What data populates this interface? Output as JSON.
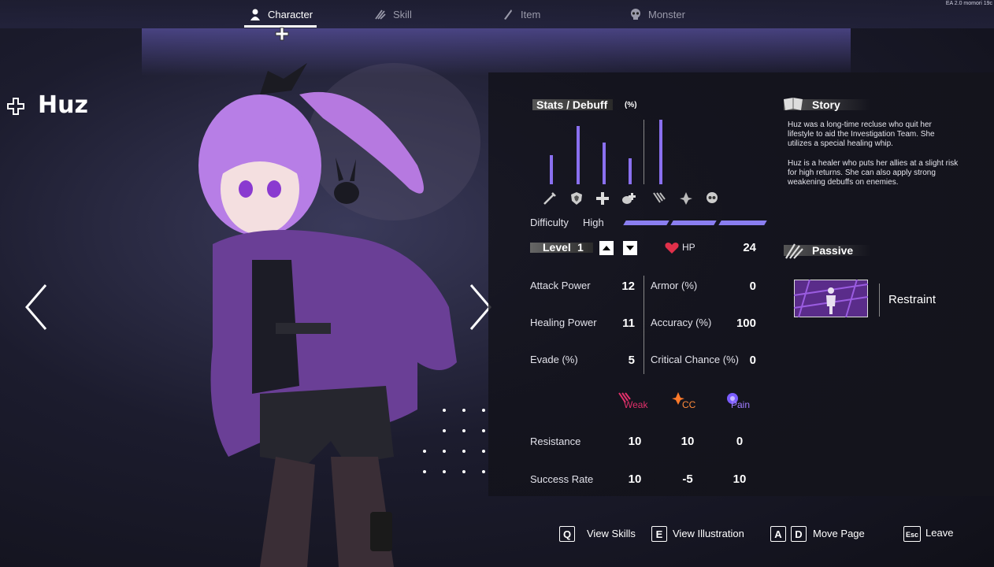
{
  "version": "EA 2.0 momori 19c",
  "tabs": [
    {
      "label": "Character",
      "icon": "person-icon",
      "active": true
    },
    {
      "label": "Skill",
      "icon": "claw-icon",
      "active": false
    },
    {
      "label": "Item",
      "icon": "knife-icon",
      "active": false
    },
    {
      "label": "Monster",
      "icon": "skull-icon",
      "active": false
    }
  ],
  "character": {
    "name": "Huz"
  },
  "stats_section": {
    "title": "Stats / Debuff",
    "unit": "(%)",
    "bars": [
      {
        "icon": "sword-icon",
        "level": 0.45
      },
      {
        "icon": "shield-icon",
        "level": 0.9
      },
      {
        "icon": "heal-plus-icon",
        "level": 0.65
      },
      {
        "icon": "speed-icon",
        "level": 0.4
      },
      {
        "icon": "weak-claw-icon",
        "level": 1.0
      },
      {
        "icon": "cc-icon",
        "level": 0.0
      },
      {
        "icon": "pain-skull-icon",
        "level": 0.0
      }
    ],
    "difficulty_label": "Difficulty",
    "difficulty_value": "High",
    "difficulty_segments": 3
  },
  "level": {
    "label": "Level",
    "value": "1"
  },
  "hp": {
    "label": "HP",
    "value": "24"
  },
  "stats": [
    {
      "label": "Attack Power",
      "value": "12"
    },
    {
      "label": "Healing Power",
      "value": "11"
    },
    {
      "label": "Evade (%)",
      "value": "5"
    },
    {
      "label": "Armor (%)",
      "value": "0"
    },
    {
      "label": "Accuracy (%)",
      "value": "100"
    },
    {
      "label": "Critical Chance (%)",
      "value": "0"
    }
  ],
  "debuffs": {
    "headers": [
      {
        "label": "Weak",
        "color": "#e0306a"
      },
      {
        "label": "CC",
        "color": "#ff7a2a"
      },
      {
        "label": "Pain",
        "color": "#9a6cff"
      }
    ],
    "rows": [
      {
        "label": "Resistance",
        "values": [
          "10",
          "10",
          "0"
        ]
      },
      {
        "label": "Success Rate",
        "values": [
          "10",
          "-5",
          "10"
        ]
      }
    ]
  },
  "story": {
    "title": "Story",
    "lines_p1": [
      "Huz was a long-time recluse who quit her",
      "lifestyle to aid the Investigation Team. She",
      "utilizes a special healing whip."
    ],
    "lines_p2": [
      "Huz is a healer who puts her allies at a slight risk",
      "for high returns. She can also apply strong",
      "weakening debuffs on enemies."
    ]
  },
  "passive": {
    "title": "Passive",
    "skill_name": "Restraint"
  },
  "hints": [
    {
      "keys": [
        "Q"
      ],
      "label": "View Skills"
    },
    {
      "keys": [
        "E"
      ],
      "label": "View Illustration"
    },
    {
      "keys": [
        "A",
        "D"
      ],
      "label": "Move Page"
    },
    {
      "keys": [
        "Esc"
      ],
      "label": "Leave"
    }
  ],
  "colors": {
    "accent": "#8a7ef0",
    "hp_heart": "#e0304a"
  }
}
